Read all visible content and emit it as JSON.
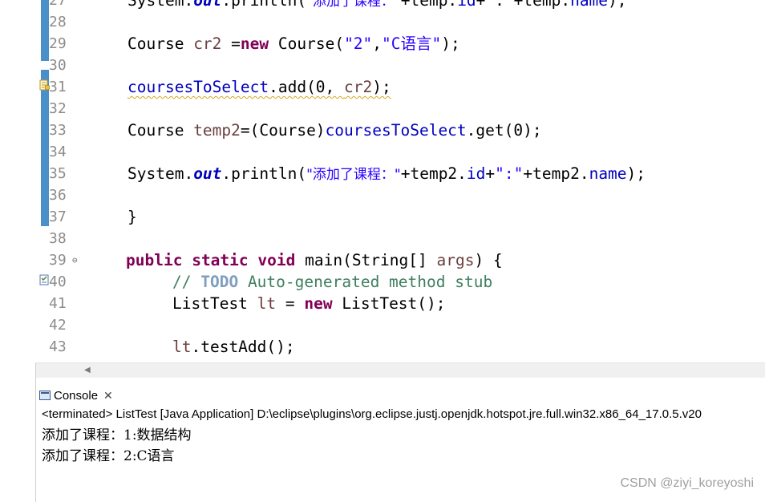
{
  "editor": {
    "line_numbers": [
      "27",
      "28",
      "29",
      "30",
      "31",
      "32",
      "33",
      "34",
      "35",
      "36",
      "37",
      "38",
      "39",
      "40",
      "41",
      "42",
      "43"
    ],
    "fold_marker": "⊖",
    "line27": {
      "a": "System.",
      "b": "out",
      "c": ".println(",
      "d": "\"添加了课程：\"",
      "e": "+temp.",
      "f": "id",
      "g": "+\":\"+temp.",
      "h": "name",
      "i": ");"
    },
    "line29": {
      "a": "Course ",
      "b": "cr2",
      "c": " =",
      "d": "new",
      "e": " Course(",
      "f": "\"2\"",
      "g": ",",
      "h": "\"C语言\"",
      "i": ");"
    },
    "line31": {
      "a": "coursesToSelect",
      "b": ".add(0, ",
      "c": "cr2",
      "d": ");"
    },
    "line33": {
      "a": "Course ",
      "b": "temp2",
      "c": "=(Course)",
      "d": "coursesToSelect",
      "e": ".get(0);"
    },
    "line35": {
      "a": "System.",
      "b": "out",
      "c": ".println(",
      "d": "\"添加了课程：\"",
      "e": "+temp2.",
      "f": "id",
      "g": "+",
      "h": "\":\"",
      "i": "+temp2.",
      "j": "name",
      "k": ");"
    },
    "line37": {
      "a": "}"
    },
    "line39": {
      "a": "public",
      "b": " ",
      "c": "static",
      "d": " ",
      "e": "void",
      "f": " main(String[] ",
      "g": "args",
      "h": ") {"
    },
    "line40": {
      "a": "// ",
      "b": "TODO",
      "c": " Auto-generated method stub"
    },
    "line41": {
      "a": "ListTest ",
      "b": "lt",
      "c": " = ",
      "d": "new",
      "e": " ListTest();"
    },
    "line43": {
      "a": "lt",
      "b": ".testAdd();"
    }
  },
  "console": {
    "tab_label": "Console",
    "close_glyph": "✕",
    "status": "<terminated> ListTest [Java Application] D:\\eclipse\\plugins\\org.eclipse.justj.openjdk.hotspot.jre.full.win32.x86_64_17.0.5.v20",
    "output": [
      "添加了课程：1:数据结构",
      "添加了课程：2:C语言"
    ]
  },
  "watermark": "CSDN @ziyi_koreyoshi",
  "colors": {
    "keyword": "#7f0055",
    "string": "#2a00ff",
    "field": "#0000c0",
    "comment": "#3f7f5f",
    "ruler": "#4a90c8"
  }
}
